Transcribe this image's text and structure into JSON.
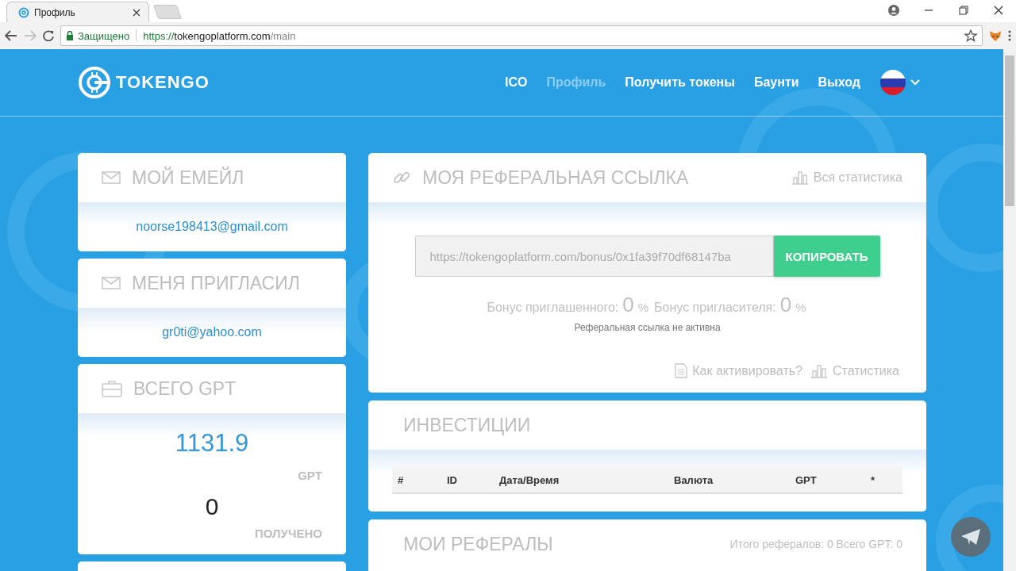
{
  "browser": {
    "tabs": [
      {
        "title": "Профиль",
        "selected": true
      }
    ],
    "secure_label": "Защищено",
    "url": {
      "scheme": "https://",
      "host": "tokengoplatform.com",
      "path": "/main"
    }
  },
  "nav": {
    "logo": "TOKENGO",
    "items": [
      {
        "label": "ICO",
        "selected": false
      },
      {
        "label": "Профиль",
        "selected": true
      },
      {
        "label": "Получить токены",
        "selected": false
      },
      {
        "label": "Баунти",
        "selected": false
      },
      {
        "label": "Выход",
        "selected": false
      }
    ]
  },
  "left_cards": [
    {
      "kind": "text",
      "title": "МОЙ ЕМЕЙЛ",
      "value": "noorse198413@gmail.com"
    },
    {
      "kind": "text",
      "title": "МЕНЯ ПРИГЛАСИЛ",
      "value": "gr0ti@yahoo.com"
    },
    {
      "kind": "total",
      "title": "ВСЕГО GPT",
      "amount": "1131.9",
      "unit": "GPT",
      "received": "0",
      "received_label": "ПОЛУЧЕНО"
    },
    {
      "kind": "empty"
    }
  ],
  "referral": {
    "title": "МОЯ РЕФЕРАЛЬНАЯ ССЫЛКА",
    "stats_link": "Вся статистика",
    "link_value": "https://tokengoplatform.com/bonus/0x1fa39f70df68147ba",
    "copy_button": "КОПИРОВАТЬ",
    "invitee_bonus_label": "Бонус приглашенного:",
    "invitee_bonus": "0",
    "invitee_bonus_unit": "%",
    "inviter_bonus_label": "Бонус пригласителя:",
    "inviter_bonus": "0",
    "inviter_bonus_unit": "%",
    "status": "Реферальная ссылка не активна",
    "activate_link": "Как активировать?",
    "statistics_link": "Статистика"
  },
  "investments": {
    "title": "ИНВЕСТИЦИИ",
    "columns": [
      "#",
      "ID",
      "Дата/Время",
      "Валюта",
      "GPT",
      "*"
    ]
  },
  "referrals": {
    "title": "МОИ РЕФЕРАЛЫ",
    "summary": "Итого рефералов: 0 Всего GPT: 0"
  }
}
